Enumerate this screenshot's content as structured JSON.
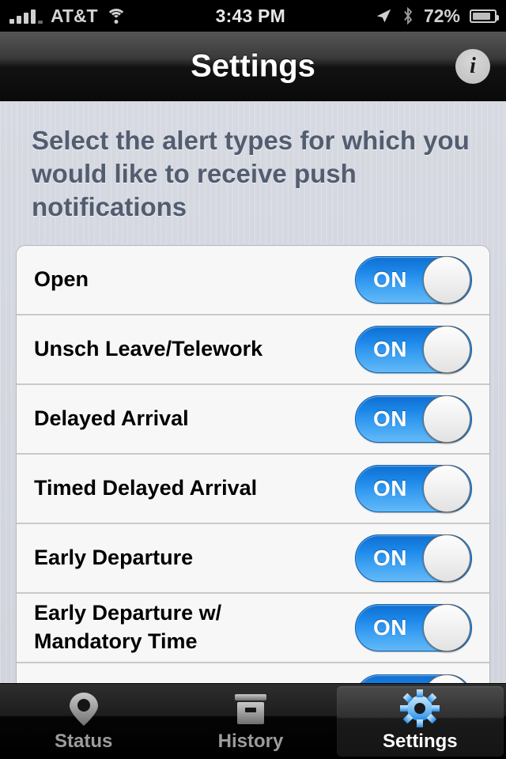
{
  "status_bar": {
    "carrier": "AT&T",
    "time": "3:43 PM",
    "battery_percent": "72%",
    "signal_bars": 4,
    "icons": [
      "signal-bars-icon",
      "wifi-icon",
      "location-arrow-icon",
      "bluetooth-icon",
      "battery-icon"
    ]
  },
  "nav_bar": {
    "title": "Settings",
    "info_button_glyph": "i"
  },
  "content": {
    "intro_text": "Select the alert types for which you would like to receive push notifications"
  },
  "alert_rows": [
    {
      "label": "Open",
      "toggle": "ON"
    },
    {
      "label": "Unsch Leave/Telework",
      "toggle": "ON"
    },
    {
      "label": "Delayed Arrival",
      "toggle": "ON"
    },
    {
      "label": "Timed Delayed Arrival",
      "toggle": "ON"
    },
    {
      "label": "Early Departure",
      "toggle": "ON"
    },
    {
      "label": "Early Departure w/\nMandatory Time",
      "toggle": "ON"
    },
    {
      "label": "",
      "toggle": "ON"
    }
  ],
  "tab_bar": {
    "tabs": [
      {
        "label": "Status",
        "icon": "map-pin-icon",
        "active": false
      },
      {
        "label": "History",
        "icon": "archive-box-icon",
        "active": false
      },
      {
        "label": "Settings",
        "icon": "gear-icon",
        "active": true
      }
    ]
  },
  "colors": {
    "toggle_on_blue": "#1b86e8",
    "page_background": "#d4d7df",
    "list_background": "#f7f7f7",
    "intro_text_color": "#525d70",
    "gear_blue": "#3399ee"
  }
}
